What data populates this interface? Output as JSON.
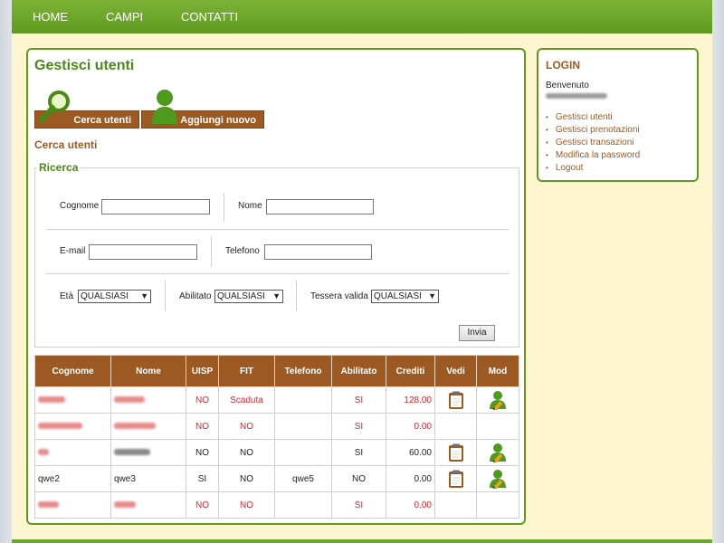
{
  "nav": {
    "items": [
      "HOME",
      "CAMPI",
      "CONTATTI"
    ]
  },
  "main": {
    "title": "Gestisci utenti",
    "btn_search": "Cerca utenti",
    "btn_add": "Aggiungi nuovo",
    "section_title": "Cerca utenti",
    "search": {
      "legend": "Ricerca",
      "cognome_label": "Cognome",
      "nome_label": "Nome",
      "email_label": "E-mail",
      "telefono_label": "Telefono",
      "eta_label": "Età",
      "eta_value": "QUALSIASI",
      "abilitato_label": "Abilitato",
      "abilitato_value": "QUALSIASI",
      "tessera_label": "Tessera valida",
      "tessera_value": "QUALSIASI",
      "submit": "Invia"
    },
    "table": {
      "headers": [
        "Cognome",
        "Nome",
        "UISP",
        "FIT",
        "Telefono",
        "Abilitato",
        "Crediti",
        "Vedi",
        "Mod"
      ],
      "rows": [
        {
          "cognome": "",
          "nome": "",
          "uisp": "NO",
          "fit": "Scaduta",
          "telefono": "",
          "abilitato": "SI",
          "crediti": "128.00",
          "vedi": true,
          "mod": true
        },
        {
          "cognome": "",
          "nome": "",
          "uisp": "NO",
          "fit": "NO",
          "telefono": "",
          "abilitato": "SI",
          "crediti": "0.00",
          "vedi": false,
          "mod": false
        },
        {
          "cognome": "",
          "nome": "",
          "uisp": "NO",
          "fit": "NO",
          "telefono": "",
          "abilitato": "SI",
          "crediti": "60.00",
          "vedi": true,
          "mod": true
        },
        {
          "cognome": "qwe2",
          "nome": "qwe3",
          "uisp": "SI",
          "fit": "NO",
          "telefono": "qwe5",
          "abilitato": "NO",
          "crediti": "0.00",
          "vedi": true,
          "mod": true
        },
        {
          "cognome": "",
          "nome": "",
          "uisp": "NO",
          "fit": "NO",
          "telefono": "",
          "abilitato": "SI",
          "crediti": "0.00",
          "vedi": false,
          "mod": false
        }
      ]
    }
  },
  "sidebar": {
    "title": "LOGIN",
    "welcome": "Benvenuto",
    "links": [
      "Gestisci utenti",
      "Gestisci prenotazioni",
      "Gestisci transazioni",
      "Modifica la password",
      "Logout"
    ]
  },
  "colors": {
    "brand_green": "#5e9a20",
    "brown": "#9c5a22",
    "alert_red": "#d8232a"
  }
}
